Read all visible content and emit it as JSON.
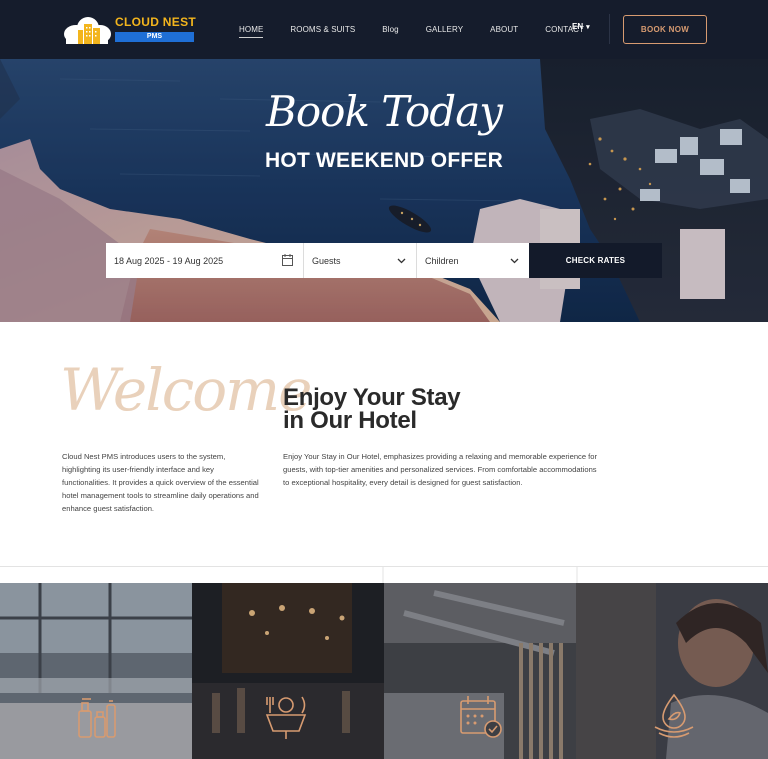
{
  "nav": {
    "logo": {
      "name": "CLOUD NEST",
      "sub": "PMS"
    },
    "menu": [
      {
        "label": "HOME",
        "active": true
      },
      {
        "label": "ROOMS & SUITS",
        "active": false
      },
      {
        "label": "Blog",
        "active": false
      },
      {
        "label": "GALLERY",
        "active": false
      },
      {
        "label": "ABOUT",
        "active": false
      },
      {
        "label": "CONTACT",
        "active": false
      }
    ],
    "language": "EN",
    "book_button": "BOOK NOW"
  },
  "hero": {
    "script": "Book Today",
    "title": "HOT WEEKEND OFFER",
    "booking": {
      "dates": "18 Aug 2025 - 19 Aug 2025",
      "guests": "Guests",
      "children": "Children",
      "button": "CHECK RATES"
    }
  },
  "welcome": {
    "script": "Welcome",
    "intro": "Cloud Nest PMS introduces users to the system, highlighting its user-friendly interface and key functionalities. It provides a quick overview of the essential hotel management tools to streamline daily operations and enhance guest satisfaction.",
    "title_line1": "Enjoy Your Stay",
    "title_line2": "in Our Hotel",
    "text": "Enjoy Your Stay in Our Hotel, emphasizes providing a relaxing and memorable experience for guests, with top-tier amenities and personalized services. From comfortable accommodations to exceptional hospitality, every detail is designed for guest satisfaction."
  },
  "features": [
    {
      "icon": "toiletries-icon"
    },
    {
      "icon": "dining-icon"
    },
    {
      "icon": "calendar-icon"
    },
    {
      "icon": "spa-icon"
    }
  ],
  "colors": {
    "nav_bg": "#151c2c",
    "accent": "#d79b71",
    "logo_gold": "#f3b51d",
    "logo_blue": "#1f6fd6",
    "check_button_bg": "#131a2a",
    "welcome_script": "#e9d1bb"
  }
}
